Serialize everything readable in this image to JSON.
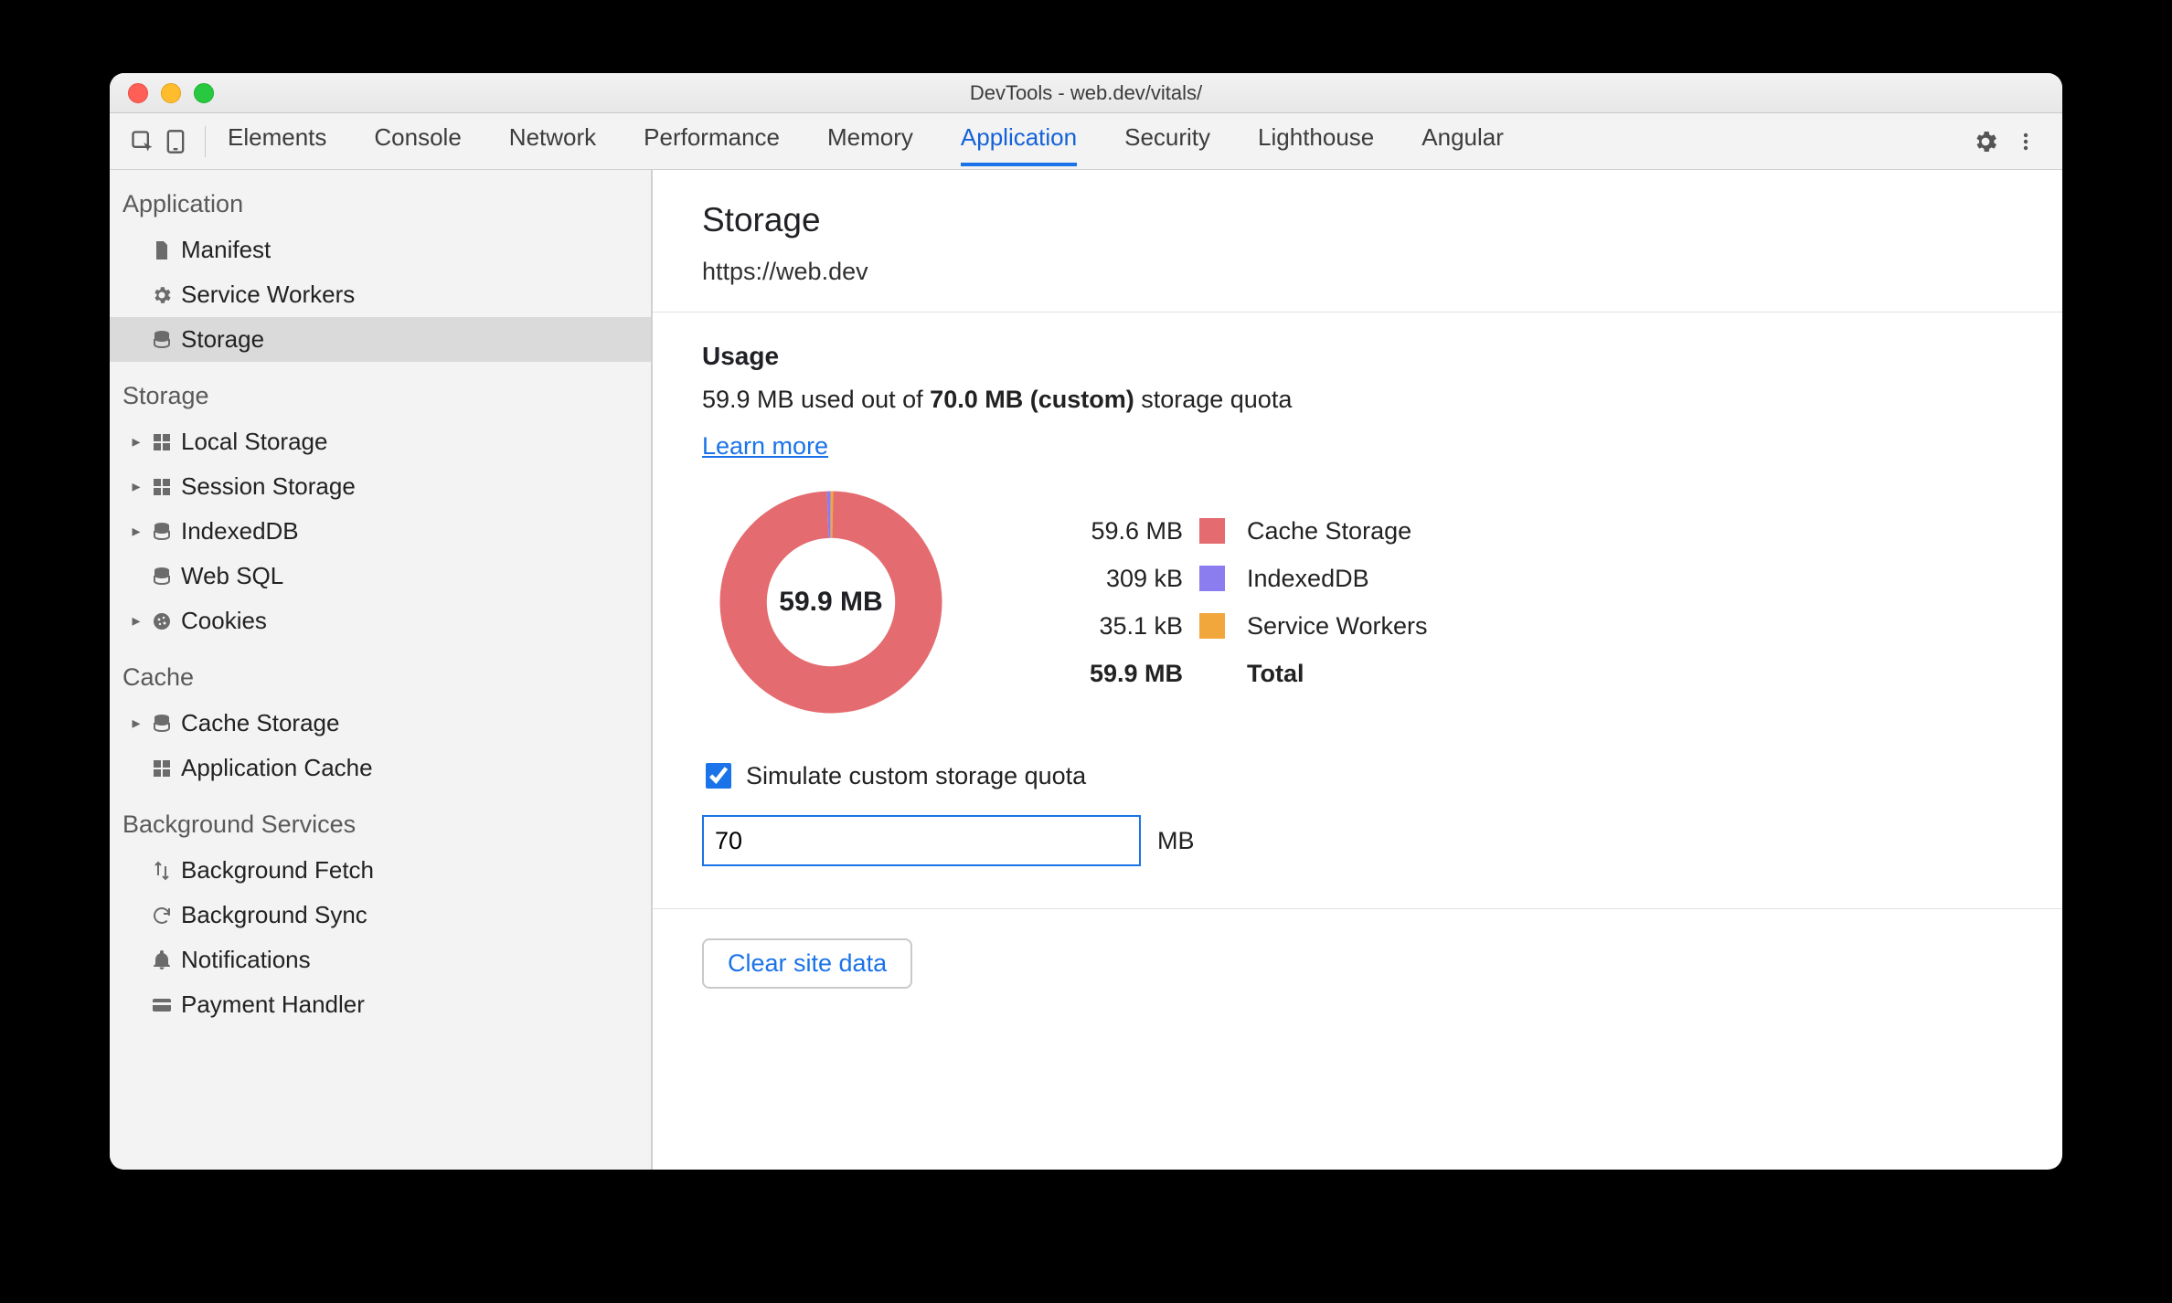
{
  "window": {
    "title": "DevTools - web.dev/vitals/"
  },
  "toolbar_tabs": [
    {
      "label": "Elements",
      "active": false
    },
    {
      "label": "Console",
      "active": false
    },
    {
      "label": "Network",
      "active": false
    },
    {
      "label": "Performance",
      "active": false
    },
    {
      "label": "Memory",
      "active": false
    },
    {
      "label": "Application",
      "active": true
    },
    {
      "label": "Security",
      "active": false
    },
    {
      "label": "Lighthouse",
      "active": false
    },
    {
      "label": "Angular",
      "active": false
    }
  ],
  "sidebar": [
    {
      "group": "Application",
      "items": [
        {
          "label": "Manifest",
          "icon": "file-icon",
          "selected": false,
          "expandable": false
        },
        {
          "label": "Service Workers",
          "icon": "gear-icon",
          "selected": false,
          "expandable": false
        },
        {
          "label": "Storage",
          "icon": "database-icon",
          "selected": true,
          "expandable": false
        }
      ]
    },
    {
      "group": "Storage",
      "items": [
        {
          "label": "Local Storage",
          "icon": "grid-icon",
          "selected": false,
          "expandable": true
        },
        {
          "label": "Session Storage",
          "icon": "grid-icon",
          "selected": false,
          "expandable": true
        },
        {
          "label": "IndexedDB",
          "icon": "database-icon",
          "selected": false,
          "expandable": true
        },
        {
          "label": "Web SQL",
          "icon": "database-icon",
          "selected": false,
          "expandable": false
        },
        {
          "label": "Cookies",
          "icon": "cookie-icon",
          "selected": false,
          "expandable": true
        }
      ]
    },
    {
      "group": "Cache",
      "items": [
        {
          "label": "Cache Storage",
          "icon": "database-icon",
          "selected": false,
          "expandable": true
        },
        {
          "label": "Application Cache",
          "icon": "grid-icon",
          "selected": false,
          "expandable": false
        }
      ]
    },
    {
      "group": "Background Services",
      "items": [
        {
          "label": "Background Fetch",
          "icon": "arrows-icon",
          "selected": false,
          "expandable": false
        },
        {
          "label": "Background Sync",
          "icon": "sync-icon",
          "selected": false,
          "expandable": false
        },
        {
          "label": "Notifications",
          "icon": "bell-icon",
          "selected": false,
          "expandable": false
        },
        {
          "label": "Payment Handler",
          "icon": "card-icon",
          "selected": false,
          "expandable": false
        }
      ]
    }
  ],
  "main": {
    "title": "Storage",
    "origin": "https://web.dev",
    "usage_heading": "Usage",
    "usage_prefix": "59.9 MB used out of ",
    "usage_bold": "70.0 MB (custom)",
    "usage_suffix": " storage quota",
    "learn_more": "Learn more",
    "donut_center": "59.9 MB",
    "legend": [
      {
        "size": "59.6 MB",
        "color": "#e46b6f",
        "name": "Cache Storage"
      },
      {
        "size": "309 kB",
        "color": "#8b7cf0",
        "name": "IndexedDB"
      },
      {
        "size": "35.1 kB",
        "color": "#f2a73d",
        "name": "Service Workers"
      }
    ],
    "total_size": "59.9 MB",
    "total_label": "Total",
    "simulate_label": "Simulate custom storage quota",
    "simulate_checked": true,
    "quota_value": "70",
    "quota_unit": "MB",
    "clear_label": "Clear site data"
  },
  "chart_data": {
    "type": "pie",
    "title": "Storage usage",
    "center_label": "59.9 MB",
    "series": [
      {
        "name": "Cache Storage",
        "value_label": "59.6 MB",
        "value_bytes": 59600000,
        "color": "#e46b6f"
      },
      {
        "name": "IndexedDB",
        "value_label": "309 kB",
        "value_bytes": 309000,
        "color": "#8b7cf0"
      },
      {
        "name": "Service Workers",
        "value_label": "35.1 kB",
        "value_bytes": 35100,
        "color": "#f2a73d"
      }
    ],
    "total_label": "59.9 MB"
  }
}
